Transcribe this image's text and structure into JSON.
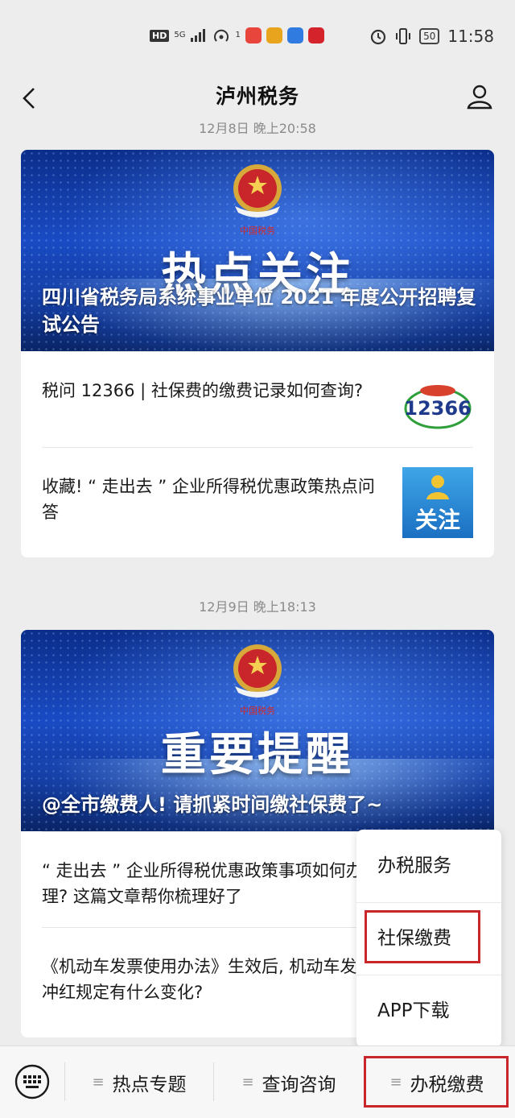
{
  "status_bar": {
    "network": "HD",
    "signal": "5G",
    "hotspot_count": "1",
    "battery": "50",
    "time": "11:58",
    "app_colors": [
      "#e8453c",
      "#e8a41c",
      "#2f7be0",
      "#d4232b"
    ]
  },
  "nav": {
    "title": "泸州税务",
    "back_icon": "chevron-left-icon",
    "user_icon": "user-icon"
  },
  "feed": [
    {
      "timestamp": "12月8日 晚上20:58",
      "banner_big_text": "热点关注",
      "banner_caption": "四川省税务局系统事业单位 2021 年度公开招聘复试公告",
      "items": [
        {
          "text": "税问 12366 | 社保费的缴费记录如何查询?",
          "thumb_icon": "12366-logo-icon"
        },
        {
          "text": "收藏! “ 走出去 ” 企业所得税优惠政策热点问答",
          "thumb_text": "关注"
        }
      ]
    },
    {
      "timestamp": "12月9日 晚上18:13",
      "banner_big_text": "重要提醒",
      "banner_caption": "@全市缴费人! 请抓紧时间缴社保费了~",
      "items": [
        {
          "text": "“ 走出去 ” 企业所得税优惠政策事项如何办理? 这篇文章帮你梳理好了"
        },
        {
          "text": "《机动车发票使用办法》生效后, 机动车发票冲红规定有什么变化?"
        }
      ]
    }
  ],
  "popup_menu": {
    "items": [
      "办税服务",
      "社保缴费",
      "APP下载"
    ],
    "highlighted": "社保缴费"
  },
  "bottom_menu": {
    "items": [
      "热点专题",
      "查询咨询",
      "办税缴费"
    ],
    "highlighted": "办税缴费",
    "keyboard_icon": "keyboard-icon"
  },
  "highlight_color": "#c8262b"
}
